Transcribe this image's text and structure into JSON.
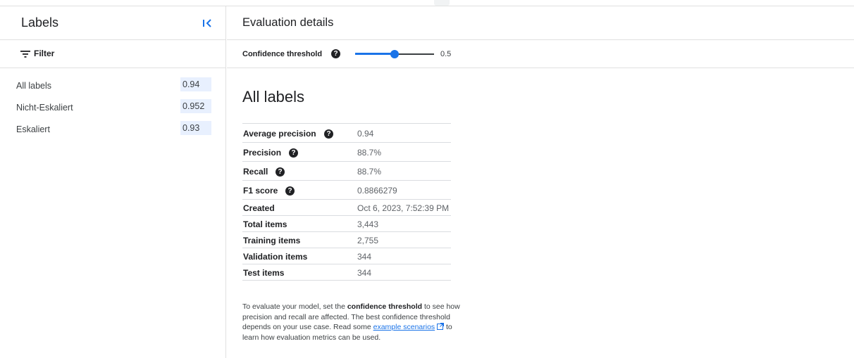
{
  "sidebar": {
    "title": "Labels",
    "filter_label": "Filter",
    "items": [
      {
        "name": "All labels",
        "score": "0.94"
      },
      {
        "name": "Nicht-Eskaliert",
        "score": "0.952"
      },
      {
        "name": "Eskaliert",
        "score": "0.93"
      }
    ]
  },
  "main": {
    "title": "Evaluation details",
    "threshold": {
      "label": "Confidence threshold",
      "value": "0.5",
      "fraction": 0.5
    },
    "section_title": "All labels",
    "metrics": [
      {
        "name": "Average precision",
        "value": "0.94",
        "help": true
      },
      {
        "name": "Precision",
        "value": "88.7%",
        "help": true
      },
      {
        "name": "Recall",
        "value": "88.7%",
        "help": true
      },
      {
        "name": "F1 score",
        "value": "0.8866279",
        "help": true
      },
      {
        "name": "Created",
        "value": "Oct 6, 2023, 7:52:39 PM",
        "help": false
      },
      {
        "name": "Total items",
        "value": "3,443",
        "help": false
      },
      {
        "name": "Training items",
        "value": "2,755",
        "help": false
      },
      {
        "name": "Validation items",
        "value": "344",
        "help": false
      },
      {
        "name": "Test items",
        "value": "344",
        "help": false
      }
    ],
    "explanation": {
      "part1": "To evaluate your model, set the ",
      "bold": "confidence threshold",
      "part2": " to see how precision and recall are affected. The best confidence threshold depends on your use case. Read some ",
      "link": "example scenarios",
      "part3": " to learn how evaluation metrics can be used."
    }
  },
  "icons": {
    "collapse": "collapse-sidebar-icon",
    "filter": "filter-icon",
    "help": "help-icon",
    "external": "open-in-new-icon"
  },
  "colors": {
    "accent": "#1a73e8",
    "score_chip": "#e8f0fe"
  }
}
